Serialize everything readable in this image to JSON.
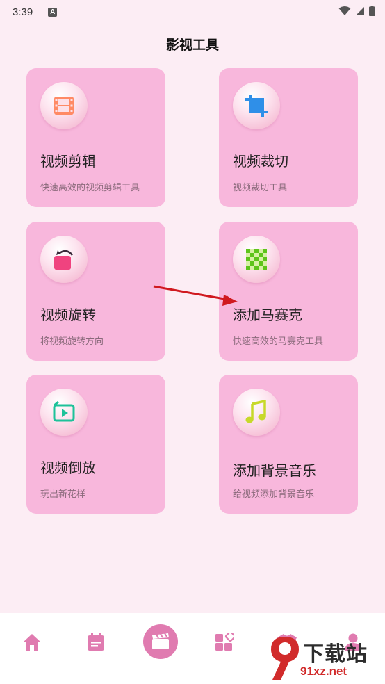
{
  "status_bar": {
    "time": "3:39",
    "notification_badge": "A"
  },
  "page": {
    "title": "影视工具"
  },
  "tools": [
    {
      "title": "视频剪辑",
      "subtitle": "快速高效的视频剪辑工具",
      "icon": "film-strip-icon"
    },
    {
      "title": "视频裁切",
      "subtitle": "视频裁切工具",
      "icon": "crop-icon"
    },
    {
      "title": "视频旋转",
      "subtitle": "将视频旋转方向",
      "icon": "rotate-icon"
    },
    {
      "title": "添加马赛克",
      "subtitle": "快速高效的马赛克工具",
      "icon": "mosaic-icon"
    },
    {
      "title": "视频倒放",
      "subtitle": "玩出新花样",
      "icon": "reverse-play-icon"
    },
    {
      "title": "添加背景音乐",
      "subtitle": "给视频添加背景音乐",
      "icon": "music-note-icon"
    }
  ],
  "bottom_nav": [
    {
      "icon": "home-icon"
    },
    {
      "icon": "calendar-icon"
    },
    {
      "icon": "clapperboard-icon",
      "active": true
    },
    {
      "icon": "apps-grid-icon"
    },
    {
      "icon": "shirt-icon"
    },
    {
      "icon": "profile-icon"
    }
  ],
  "watermark": {
    "brand": "下载站",
    "url": "91xz.net",
    "logo_text": "9"
  },
  "colors": {
    "background": "#fcedf4",
    "card": "#f8b7dc",
    "accent": "#e07bb0",
    "annotation_arrow": "#d0191f"
  }
}
